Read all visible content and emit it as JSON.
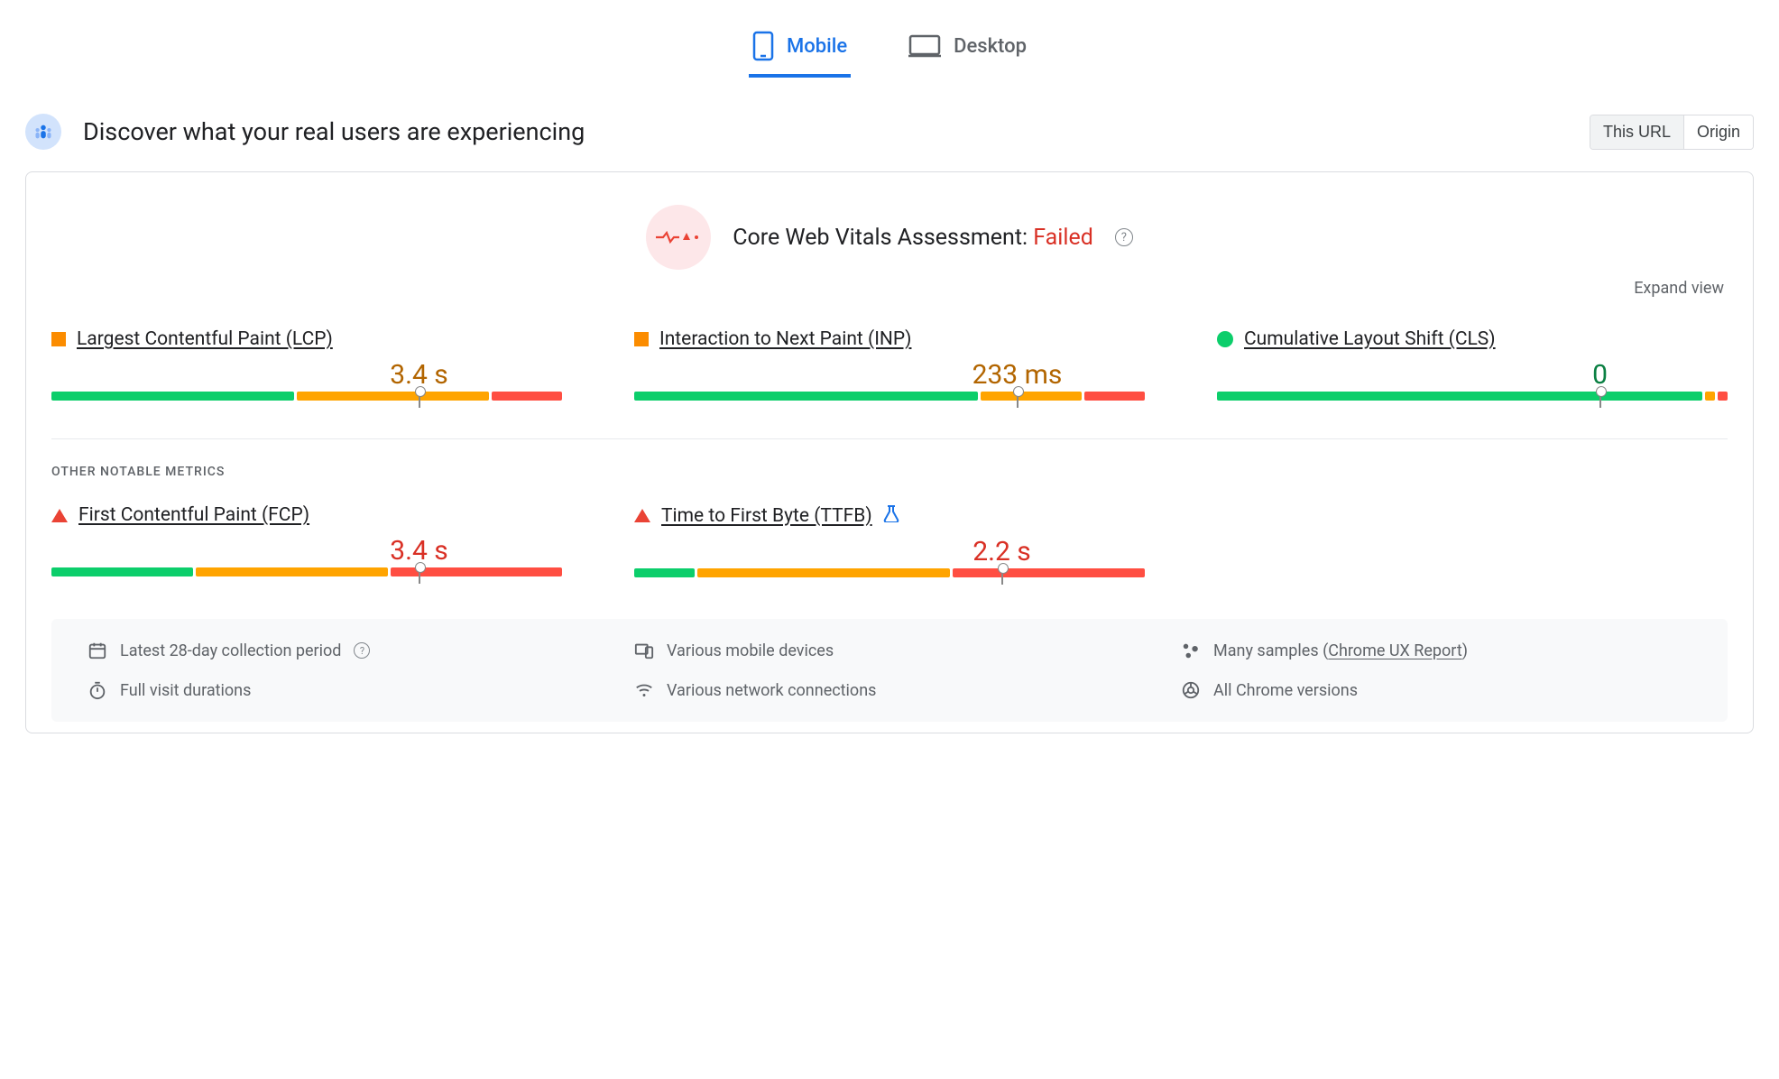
{
  "tabs": {
    "mobile": "Mobile",
    "desktop": "Desktop",
    "active": "mobile"
  },
  "header": {
    "title": "Discover what your real users are experiencing"
  },
  "scope": {
    "this_url": "This URL",
    "origin": "Origin",
    "active": "this_url"
  },
  "assessment": {
    "label": "Core Web Vitals Assessment:",
    "status": "Failed",
    "status_color": "#d93025"
  },
  "expand_label": "Expand view",
  "section_other": "OTHER NOTABLE METRICS",
  "metrics_core": [
    {
      "id": "lcp",
      "name": "Largest Contentful Paint (LCP)",
      "icon": "square-orange",
      "value": "3.4 s",
      "value_class": "val-orange",
      "marker_pct": 72,
      "segments": [
        48,
        38,
        14
      ]
    },
    {
      "id": "inp",
      "name": "Interaction to Next Paint (INP)",
      "icon": "square-orange",
      "value": "233 ms",
      "value_class": "val-orange",
      "marker_pct": 75,
      "segments": [
        68,
        20,
        12
      ]
    },
    {
      "id": "cls",
      "name": "Cumulative Layout Shift (CLS)",
      "icon": "dot-green",
      "value": "0",
      "value_class": "val-green",
      "marker_pct": 75,
      "segments": [
        96,
        2,
        2
      ]
    }
  ],
  "metrics_other": [
    {
      "id": "fcp",
      "name": "First Contentful Paint (FCP)",
      "icon": "tri-red",
      "value": "3.4 s",
      "value_class": "val-red",
      "marker_pct": 72,
      "segments": [
        28,
        38,
        34
      ]
    },
    {
      "id": "ttfb",
      "name": "Time to First Byte (TTFB)",
      "icon": "tri-red",
      "flask": true,
      "value": "2.2 s",
      "value_class": "val-red",
      "marker_pct": 72,
      "segments": [
        12,
        50,
        38
      ]
    }
  ],
  "notes": {
    "period": "Latest 28-day collection period",
    "devices": "Various mobile devices",
    "samples_prefix": "Many samples (",
    "samples_link": "Chrome UX Report",
    "samples_suffix": ")",
    "durations": "Full visit durations",
    "network": "Various network connections",
    "versions": "All Chrome versions"
  }
}
